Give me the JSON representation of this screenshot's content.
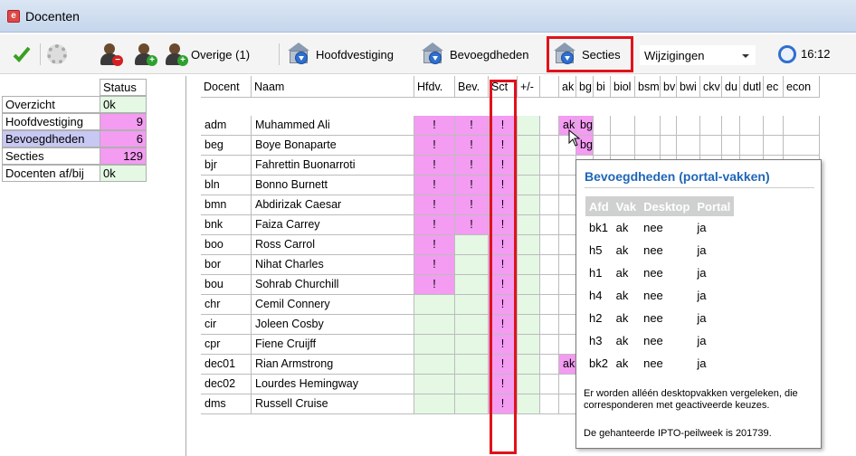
{
  "window": {
    "title": "Docenten"
  },
  "toolbar": {
    "overige_label": "Overige (1)",
    "hoofdvestiging_label": "Hoofdvestiging",
    "bevoegdheden_label": "Bevoegdheden",
    "secties_label": "Secties",
    "wijzigingen_value": "Wijzigingen",
    "time": "16:12"
  },
  "status_panel": {
    "header": "Status",
    "rows": [
      {
        "name": "Overzicht",
        "value": "0k",
        "color": "#e4f8e4"
      },
      {
        "name": "Hoofdvestiging",
        "value": "9",
        "color": "#f39cf2"
      },
      {
        "name": "Bevoegdheden",
        "value": "6",
        "color": "#f39cf2"
      },
      {
        "name": "Secties",
        "value": "129",
        "color": "#f39cf2"
      },
      {
        "name": "Docenten af/bij",
        "value": "0k",
        "color": "#e4f8e4"
      }
    ]
  },
  "grid": {
    "headers": {
      "docent": "Docent",
      "naam": "Naam",
      "hfdv": "Hfdv.",
      "bev": "Bev.",
      "sct": "Sct",
      "plusmin": "+/-",
      "subjects": [
        "ak",
        "bg",
        "bi",
        "biol",
        "bsm",
        "bv",
        "bwi",
        "ckv",
        "du",
        "dutl",
        "ec",
        "econ"
      ]
    },
    "rows": [
      {
        "code": "adm",
        "naam": "Muhammed Ali",
        "hfdv": "!",
        "bev": "!",
        "sct": "!",
        "ak": "ak",
        "bg": "bg"
      },
      {
        "code": "beg",
        "naam": "Boye Bonaparte",
        "hfdv": "!",
        "bev": "!",
        "sct": "!",
        "ak": "",
        "bg": "bg"
      },
      {
        "code": "bjr",
        "naam": "Fahrettin Buonarroti",
        "hfdv": "!",
        "bev": "!",
        "sct": "!",
        "ak": "",
        "bg": ""
      },
      {
        "code": "bln",
        "naam": "Bonno Burnett",
        "hfdv": "!",
        "bev": "!",
        "sct": "!",
        "ak": "",
        "bg": ""
      },
      {
        "code": "bmn",
        "naam": "Abdirizak Caesar",
        "hfdv": "!",
        "bev": "!",
        "sct": "!",
        "ak": "",
        "bg": ""
      },
      {
        "code": "bnk",
        "naam": "Faiza Carrey",
        "hfdv": "!",
        "bev": "!",
        "sct": "!",
        "ak": "",
        "bg": ""
      },
      {
        "code": "boo",
        "naam": "Ross Carrol",
        "hfdv": "!",
        "bev": "",
        "sct": "!",
        "ak": "",
        "bg": ""
      },
      {
        "code": "bor",
        "naam": "Nihat Charles",
        "hfdv": "!",
        "bev": "",
        "sct": "!",
        "ak": "",
        "bg": ""
      },
      {
        "code": "bou",
        "naam": "Sohrab Churchill",
        "hfdv": "!",
        "bev": "",
        "sct": "!",
        "ak": "",
        "bg": ""
      },
      {
        "code": "chr",
        "naam": "Cemil Connery",
        "hfdv": "",
        "bev": "",
        "sct": "!",
        "ak": "",
        "bg": ""
      },
      {
        "code": "cir",
        "naam": "Joleen Cosby",
        "hfdv": "",
        "bev": "",
        "sct": "!",
        "ak": "",
        "bg": ""
      },
      {
        "code": "cpr",
        "naam": "Fiene Cruijff",
        "hfdv": "",
        "bev": "",
        "sct": "!",
        "ak": "",
        "bg": ""
      },
      {
        "code": "dec01",
        "naam": "Rian Armstrong",
        "hfdv": "",
        "bev": "",
        "sct": "!",
        "ak": "ak",
        "bg": ""
      },
      {
        "code": "dec02",
        "naam": "Lourdes Hemingway",
        "hfdv": "",
        "bev": "",
        "sct": "!",
        "ak": "",
        "bg": ""
      },
      {
        "code": "dms",
        "naam": "Russell Cruise",
        "hfdv": "",
        "bev": "",
        "sct": "!",
        "ak": "",
        "bg": ""
      }
    ]
  },
  "popup": {
    "title": "Bevoegdheden (portal-vakken)",
    "columns": [
      "Afd",
      "Vak",
      "Desktop",
      "Portal"
    ],
    "rows": [
      [
        "bk1",
        "ak",
        "nee",
        "ja"
      ],
      [
        "h5",
        "ak",
        "nee",
        "ja"
      ],
      [
        "h1",
        "ak",
        "nee",
        "ja"
      ],
      [
        "h4",
        "ak",
        "nee",
        "ja"
      ],
      [
        "h2",
        "ak",
        "nee",
        "ja"
      ],
      [
        "h3",
        "ak",
        "nee",
        "ja"
      ],
      [
        "bk2",
        "ak",
        "nee",
        "ja"
      ]
    ],
    "note1": "Er worden alléén desktopvakken vergeleken, die corresponderen met geactiveerde keuzes.",
    "note2": "De gehanteerde IPTO-peilweek is 201739."
  },
  "colors": {
    "pink": "#f39cf2",
    "green": "#e4f8e4",
    "highlight": "#e0121b",
    "selected": "#c8c8f4"
  }
}
